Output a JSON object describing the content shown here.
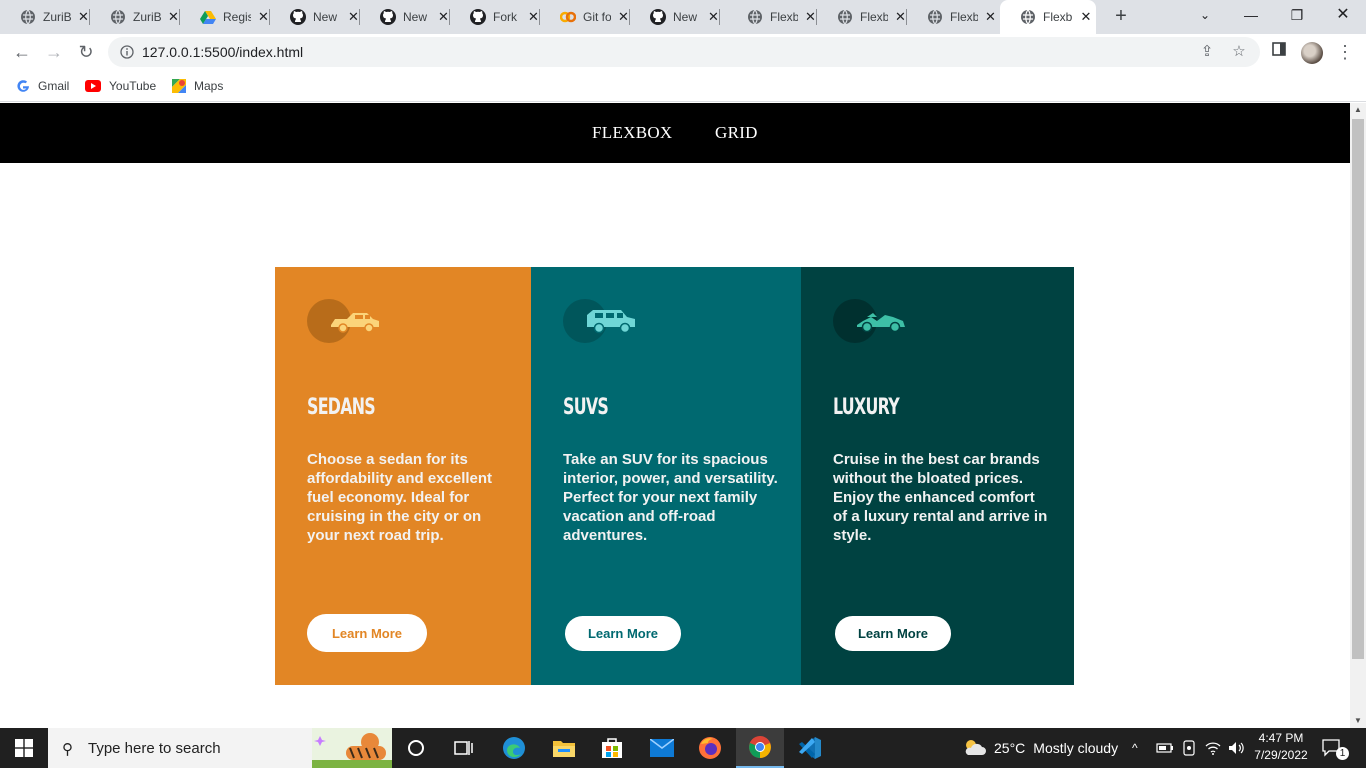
{
  "browser": {
    "tabs": [
      {
        "title": "ZuriB",
        "icon": "globe-icon"
      },
      {
        "title": "ZuriB",
        "icon": "globe-icon"
      },
      {
        "title": "Regis",
        "icon": "google-drive-icon"
      },
      {
        "title": "New",
        "icon": "github-icon"
      },
      {
        "title": "New",
        "icon": "github-icon"
      },
      {
        "title": "Fork",
        "icon": "github-icon"
      },
      {
        "title": "Git fo",
        "icon": "colab-icon"
      },
      {
        "title": "New",
        "icon": "github-icon"
      },
      {
        "title": "Flexb",
        "icon": "globe-icon"
      },
      {
        "title": "Flexb",
        "icon": "globe-icon"
      },
      {
        "title": "Flexb",
        "icon": "globe-icon"
      },
      {
        "title": "Flexb",
        "icon": "globe-icon",
        "active": true
      }
    ],
    "url": "127.0.0.1:5500/index.html",
    "bookmarks": [
      {
        "label": "Gmail",
        "icon": "google-icon"
      },
      {
        "label": "YouTube",
        "icon": "youtube-icon"
      },
      {
        "label": "Maps",
        "icon": "maps-icon"
      }
    ]
  },
  "site": {
    "nav": {
      "flexbox": "FLEXBOX",
      "grid": "GRID"
    },
    "cards": [
      {
        "title": "Sedans",
        "text": "Choose a sedan for its affordability and excellent fuel economy. Ideal for cruising in the city or on your next road trip.",
        "button": "Learn More",
        "bg": "#e28625",
        "accent": "#e28625",
        "icon": "sedan-icon"
      },
      {
        "title": "SUVs",
        "text": "Take an SUV for its spacious interior, power, and versatility. Perfect for your next family vacation and off-road adventures.",
        "button": "Learn More",
        "bg": "#006970",
        "accent": "#006970",
        "icon": "suv-icon"
      },
      {
        "title": "Luxury",
        "text": "Cruise in the best car brands without the bloated prices. Enjoy the enhanced comfort of a luxury rental and arrive in style.",
        "button": "Learn More",
        "bg": "#004241",
        "accent": "#004241",
        "icon": "luxury-car-icon"
      }
    ]
  },
  "taskbar": {
    "search_placeholder": "Type here to search",
    "weather_temp": "25°C",
    "weather_text": "Mostly cloudy",
    "time": "4:47 PM",
    "date": "7/29/2022",
    "notifications": "1"
  }
}
